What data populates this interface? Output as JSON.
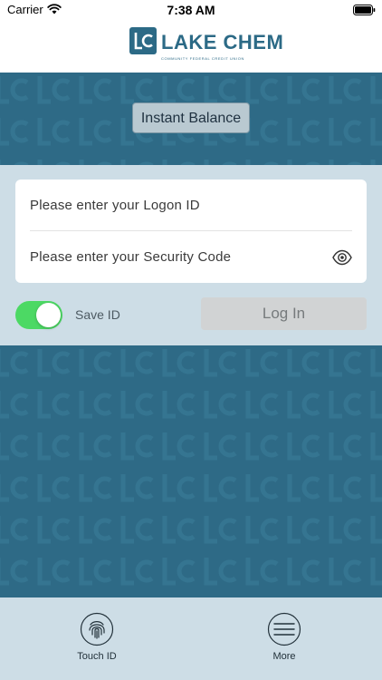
{
  "status_bar": {
    "carrier": "Carrier",
    "time": "7:38 AM"
  },
  "brand": {
    "name": "LAKE CHEM",
    "tagline": "COMMUNITY FEDERAL CREDIT UNION",
    "primary_color": "#2c6a86"
  },
  "instant_balance": {
    "label": "Instant Balance"
  },
  "login": {
    "logon_placeholder": "Please enter your Logon ID",
    "security_placeholder": "Please enter your Security Code",
    "save_id_label": "Save ID",
    "save_id_enabled": true,
    "login_label": "Log In",
    "toggle_color": "#4cd964"
  },
  "tab_bar": {
    "items": [
      {
        "label": "Touch ID",
        "icon": "fingerprint-icon"
      },
      {
        "label": "More",
        "icon": "menu-icon"
      }
    ]
  }
}
